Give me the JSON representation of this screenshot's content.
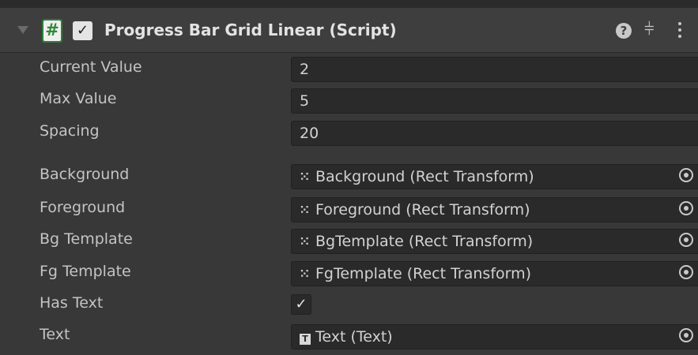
{
  "component": {
    "title": "Progress Bar Grid Linear (Script)",
    "script_icon": "#",
    "enabled_check": "✓",
    "help_glyph": "?",
    "preset_glyph": "⫩",
    "icons": [
      "foldout-arrow-icon",
      "script-icon",
      "help-icon",
      "presets-icon",
      "context-menu-icon"
    ]
  },
  "fields": {
    "current_value": {
      "label": "Current Value",
      "value": "2"
    },
    "max_value": {
      "label": "Max Value",
      "value": "5"
    },
    "spacing": {
      "label": "Spacing",
      "value": "20"
    },
    "background": {
      "label": "Background",
      "value": "Background (Rect Transform)",
      "icon": "⁙"
    },
    "foreground": {
      "label": "Foreground",
      "value": "Foreground (Rect Transform)",
      "icon": "⁙"
    },
    "bg_template": {
      "label": "Bg Template",
      "value": "BgTemplate (Rect Transform)",
      "icon": "⁙"
    },
    "fg_template": {
      "label": "Fg Template",
      "value": "FgTemplate (Rect Transform)",
      "icon": "⁙"
    },
    "has_text": {
      "label": "Has Text",
      "check": "✓"
    },
    "text": {
      "label": "Text",
      "value": "Text (Text)",
      "icon": "T"
    }
  },
  "colors": {
    "background": "#383838",
    "header": "#3e3e3e",
    "field": "#2a2a2a",
    "script_green": "#2e8a3a"
  }
}
